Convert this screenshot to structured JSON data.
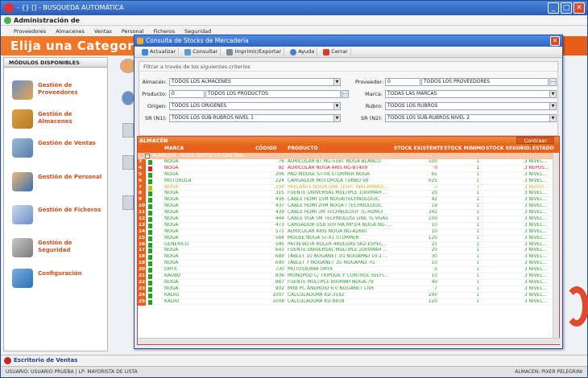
{
  "window": {
    "title": "- {} [] - BUSQUEDA AUTOMÁTICA",
    "subtitle": "Administración de"
  },
  "menu": [
    "Proveedores",
    "Almacenes",
    "Ventas",
    "Personal",
    "Ficheros",
    "Seguridad"
  ],
  "banner": {
    "title": "Elija una Categoría"
  },
  "left_panel": {
    "header": "MÓDULOS DISPONIBLES",
    "items": [
      {
        "label": "Gestión de Proveedores",
        "icon": "people-icon"
      },
      {
        "label": "Gestión de Almacenes",
        "icon": "boxes-icon"
      },
      {
        "label": "Gestión de Ventas",
        "icon": "cash-register-icon"
      },
      {
        "label": "Gestión de Personal",
        "icon": "person-icon"
      },
      {
        "label": "Gestión de Ficheros",
        "icon": "files-icon"
      },
      {
        "label": "Gestión de Seguridad",
        "icon": "lock-icon"
      },
      {
        "label": "Configuración",
        "icon": "checklist-icon"
      }
    ]
  },
  "statusbar": {
    "text": "Escritorio de Ventas"
  },
  "footer": {
    "left": "USUARIO: USUARIO PRUEBA  |  LP: MAYORISTA DE LISTA",
    "right": "ALMACEN: PIXER PELEGRINI"
  },
  "dialog": {
    "title": "Consulta de Stocks de Mercadería",
    "toolbar": [
      "Actualizar",
      "Consultar",
      "Imprimir/Exportar",
      "Ayuda",
      "Cerrar"
    ],
    "filter_header": "Filtrar a través de los siguientes criterios",
    "fields": {
      "almacen_label": "Almacén:",
      "almacen_value": "TODOS LOS ALMACENES",
      "producto_label": "Producto:",
      "producto_code": "0",
      "producto_value": "TODOS LOS PRODUCTOS",
      "origen_label": "Origen:",
      "origen_value": "TODOS LOS ORIGENES",
      "sr1_label": "SR (N1):",
      "sr1_value": "TODOS LOS SUB-RUBROS NIVEL 1",
      "proveedor_label": "Proveedor:",
      "proveedor_code": "0",
      "proveedor_value": "TODOS LOS PROVEEDORES",
      "marca_label": "Marca:",
      "marca_value": "TODAS LAS MARCAS",
      "rubro_label": "Rubro:",
      "rubro_value": "TODOS LOS RUBROS",
      "sr2_label": "SR (N2):",
      "sr2_value": "TODOS LOS SUB-RUBROS NIVEL 2"
    },
    "grid": {
      "tab": "ALMACÉN",
      "contraer": "Contraer",
      "columns": [
        "MARCA",
        "CÓDIGO",
        "PRODUCTO",
        "STOCK EXISTENTE",
        "STOCK MINIMO",
        "STOCK SEGURIDAD",
        "ESTADO"
      ],
      "group": "ALMACEN : PIXER DEPOSITO CENTRAL",
      "rows": [
        {
          "n": "3",
          "marca": "NOGA",
          "codigo": "76",
          "producto": "AURICULAR BT NG-55BT NOGA BLANCO",
          "stock": "100",
          "min": "1",
          "estado": "3  NIVEL...",
          "color": "#2a9d2a"
        },
        {
          "n": "4",
          "marca": "NOGA",
          "codigo": "92",
          "producto": "AURICULAR NOGA ARIS NG-BT409",
          "stock": "0",
          "min": "1",
          "estado": "3  REPOS...",
          "color": "#e0202a"
        },
        {
          "n": "5",
          "marca": "NOGA",
          "codigo": "206",
          "producto": "PAD MOUSE ST-08 STORMER NOGA",
          "stock": "65",
          "min": "1",
          "estado": "3  NIVEL...",
          "color": "#2a9d2a"
        },
        {
          "n": "6",
          "marca": "MOTOROLA",
          "codigo": "224",
          "producto": "CARGADOR MOTOROLA TURBO V8",
          "stock": "625",
          "min": "1",
          "estado": "3  NIVEL...",
          "color": "#2a9d2a"
        },
        {
          "n": "7",
          "marca": "NOGA",
          "codigo": "294",
          "producto": "PARLANTE NOGA ONE LIGHT INALAMBRIC...",
          "stock": "3",
          "min": "3",
          "estado": "3  REPOS...",
          "color": "#c9b820"
        },
        {
          "n": "8",
          "marca": "NOGA",
          "codigo": "315",
          "producto": "FUENTE UNIVERSAL MULTIPLE 1000MAH ...",
          "stock": "20",
          "min": "1",
          "estado": "3  NIVEL...",
          "color": "#2a9d2a"
        },
        {
          "n": "9",
          "marca": "NOGA",
          "codigo": "436",
          "producto": "CABLE HDMI 15M NOGA/TECHNOLOGIC",
          "stock": "42",
          "min": "1",
          "estado": "3  NIVEL...",
          "color": "#2a9d2a"
        },
        {
          "n": "10",
          "marca": "NOGA",
          "codigo": "437",
          "producto": "CABLE HDMI 20M NOGA / TECHNOLOGIC",
          "stock": "19",
          "min": "1",
          "estado": "3  NIVEL...",
          "color": "#2a9d2a"
        },
        {
          "n": "11",
          "marca": "NOGA",
          "codigo": "439",
          "producto": "CABLE HDMI 3M TECHNOLOGY TL-HDMI3",
          "stock": "342",
          "min": "1",
          "estado": "3  NIVEL...",
          "color": "#2a9d2a"
        },
        {
          "n": "12",
          "marca": "NOGA",
          "codigo": "444",
          "producto": "CABLE VGA 5M TECHNOLOGI LINE TL-VGA5",
          "stock": "100",
          "min": "1",
          "estado": "3  NIVEL...",
          "color": "#2a9d2a"
        },
        {
          "n": "13",
          "marca": "NOGA",
          "codigo": "473",
          "producto": "CARGADOR USB 500 MA MP3/4 NOGA NG-...",
          "stock": "10",
          "min": "1",
          "estado": "3  NIVEL...",
          "color": "#2a9d2a"
        },
        {
          "n": "14",
          "marca": "NOGA",
          "codigo": "571",
          "producto": "AURICULAR ARIS NOGA NG-A26BT",
          "stock": "10",
          "min": "1",
          "estado": "3  NIVEL...",
          "color": "#2a9d2a"
        },
        {
          "n": "15",
          "marca": "NOGA",
          "codigo": "584",
          "producto": "MOUSE NOGA ST-X1 STORMER",
          "stock": "120",
          "min": "1",
          "estado": "3  NIVEL...",
          "color": "#2a9d2a"
        },
        {
          "n": "16",
          "marca": "GENERICO",
          "codigo": "595",
          "producto": "PATIN BOTA ROLER 4RUEDAS SK2-ESPEC...",
          "stock": "25",
          "min": "1",
          "estado": "3  NIVEL...",
          "color": "#2a9d2a"
        },
        {
          "n": "17",
          "marca": "NOGA",
          "codigo": "643",
          "producto": "FUENTE UNIVERSAL MULTIPLE 2000MAH ...",
          "stock": "20",
          "min": "1",
          "estado": "3  NIVEL...",
          "color": "#2a9d2a"
        },
        {
          "n": "18",
          "marca": "NOGA",
          "codigo": "689",
          "producto": "TABLET 10 NOGANET 3G NOGAPAD 10.1 ...",
          "stock": "30",
          "min": "1",
          "estado": "3  NIVEL...",
          "color": "#2a9d2a"
        },
        {
          "n": "19",
          "marca": "NOGA",
          "codigo": "690",
          "producto": "TABLET 7 NOGANET 3G NOGAPAD 7G",
          "stock": "10",
          "min": "1",
          "estado": "3  NIVEL...",
          "color": "#2a9d2a"
        },
        {
          "n": "20",
          "marca": "ORYX",
          "codigo": "730",
          "producto": "MOTOSIERRA ORYX",
          "stock": "5",
          "min": "1",
          "estado": "3  NIVEL...",
          "color": "#2a9d2a"
        },
        {
          "n": "21",
          "marca": "KAUBU",
          "codigo": "836",
          "producto": "MONOPOD C/ TRIPODE Y CONTROL SELFI...",
          "stock": "10",
          "min": "1",
          "estado": "3  NIVEL...",
          "color": "#2a9d2a"
        },
        {
          "n": "22",
          "marca": "NOGA",
          "codigo": "887",
          "producto": "FUENTE MULTIPLE 800MAH NOGA-79",
          "stock": "40",
          "min": "1",
          "estado": "3  NIVEL...",
          "color": "#2a9d2a"
        },
        {
          "n": "23",
          "marca": "NOGA",
          "codigo": "902",
          "producto": "MINI PC ANDROID 6.0 NOGANET LIVE",
          "stock": "7",
          "min": "1",
          "estado": "3  NIVEL...",
          "color": "#2a9d2a"
        },
        {
          "n": "24",
          "marca": "KADIO",
          "codigo": "1007",
          "producto": "CALCULADORA KD-3182",
          "stock": "240",
          "min": "1",
          "estado": "3  NIVEL...",
          "color": "#2a9d2a"
        },
        {
          "n": "25",
          "marca": "KADIO",
          "codigo": "1008",
          "producto": "CALCULADORA KD-8818",
          "stock": "120",
          "min": "1",
          "estado": "3  NIVEL...",
          "color": "#2a9d2a"
        }
      ]
    }
  }
}
